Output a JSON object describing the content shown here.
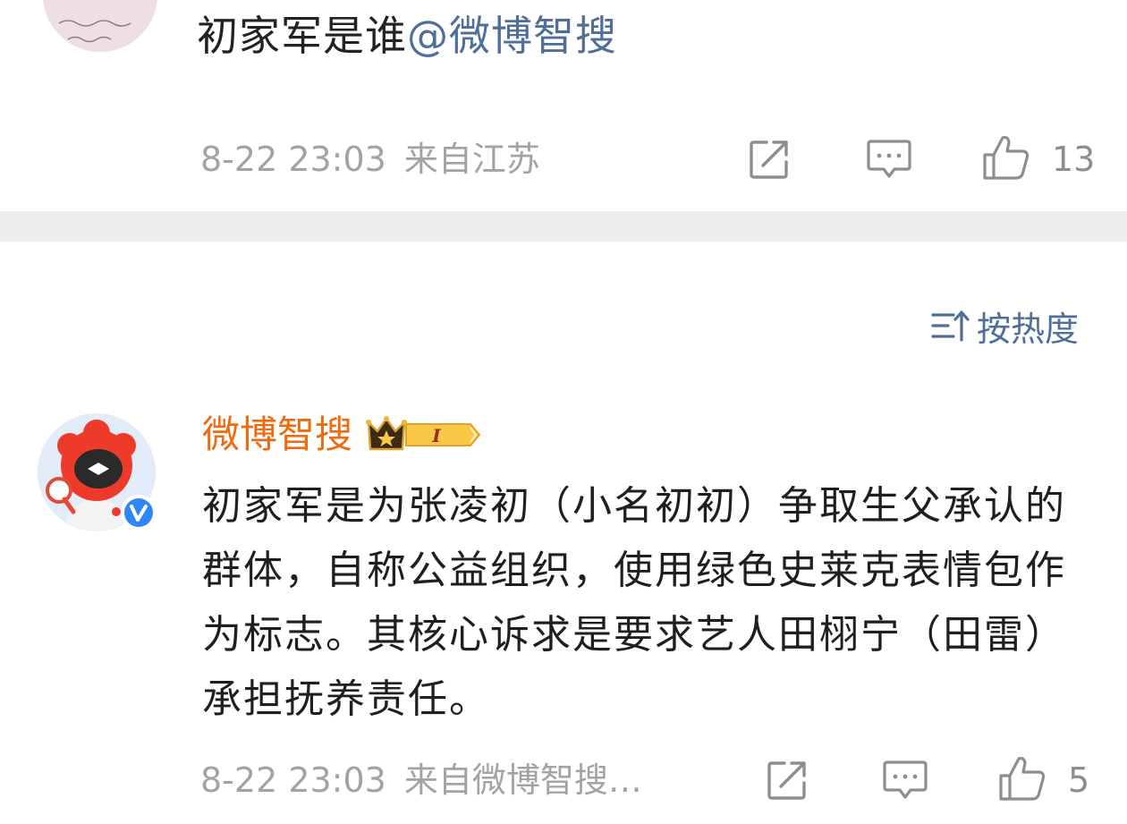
{
  "post": {
    "text": "初家军是谁",
    "mention": "@微博智搜",
    "time": "8-22 23:03",
    "location": "来自江苏",
    "like_count": "13",
    "icons": [
      "share-icon",
      "comment-icon",
      "like-icon"
    ]
  },
  "comments": {
    "sort_label": "按热度",
    "sort_icon": "sort-icon",
    "items": [
      {
        "username": "微博智搜",
        "badge_text": "I",
        "verified": true,
        "text": "初家军是为张凌初（小名初初）争取生父承认的群体，自称公益组织，使用绿色史莱克表情包作为标志。其核心诉求是要求艺人田栩宁（田雷）承担抚养责任。",
        "time": "8-22 23:03",
        "source": "来自微博智搜…",
        "like_count": "5"
      }
    ]
  },
  "colors": {
    "link_blue": "#4f6e99",
    "username_orange": "#f06a10",
    "meta_gray": "#a3a3a3",
    "divider": "#ececec",
    "verified_blue": "#2f86f6"
  }
}
